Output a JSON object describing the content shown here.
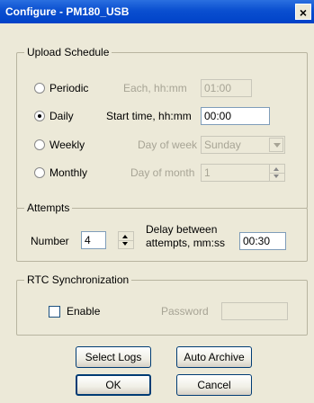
{
  "window": {
    "title": "Configure - PM180_USB",
    "close_glyph": "×"
  },
  "upload_schedule": {
    "legend": "Upload Schedule",
    "options": [
      {
        "label": "Periodic",
        "checked": false,
        "detail_label": "Each, hh:mm",
        "value": "01:00",
        "enabled": false
      },
      {
        "label": "Daily",
        "checked": true,
        "detail_label": "Start time, hh:mm",
        "value": "00:00",
        "enabled": true
      },
      {
        "label": "Weekly",
        "checked": false,
        "detail_label": "Day of week",
        "value": "Sunday",
        "enabled": false
      },
      {
        "label": "Monthly",
        "checked": false,
        "detail_label": "Day of month",
        "value": "1",
        "enabled": false
      }
    ]
  },
  "attempts": {
    "legend": "Attempts",
    "number_label": "Number",
    "number_value": "4",
    "delay_label_line1": "Delay between",
    "delay_label_line2": "attempts, mm:ss",
    "delay_value": "00:30"
  },
  "rtc": {
    "legend": "RTC Synchronization",
    "enable_label": "Enable",
    "enable_checked": false,
    "password_label": "Password",
    "password_value": ""
  },
  "buttons": {
    "select_logs": "Select Logs",
    "auto_archive": "Auto Archive",
    "ok": "OK",
    "cancel": "Cancel"
  }
}
